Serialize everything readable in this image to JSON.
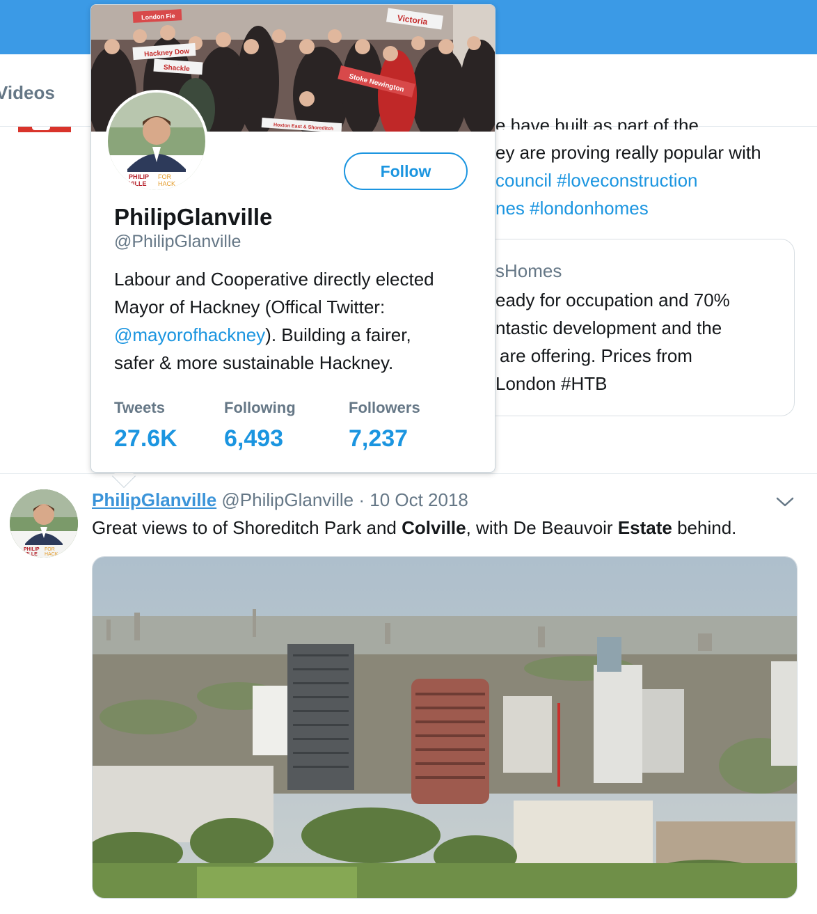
{
  "tabs": {
    "videos": "Videos"
  },
  "background_tweet": {
    "text_lines": [
      "e have built as part of the",
      "ey are proving really popular with",
      "council #loveconstruction",
      "nes #londonhomes"
    ],
    "quote": {
      "source": "sHomes",
      "lines": [
        "eady for occupation and 70%",
        "ntastic development and the",
        "are offering. Prices from",
        "London #HTB"
      ]
    }
  },
  "profile_card": {
    "follow_label": "Follow",
    "name": "PhilipGlanville",
    "handle": "@PhilipGlanville",
    "bio_lines": [
      "Labour and Cooperative directly elected",
      "Mayor of Hackney (Offical Twitter:",
      "). Building a fairer,",
      "safer & more sustainable Hackney."
    ],
    "bio_mention": "@mayorofhackney",
    "avatar_badge": {
      "line1": "PHILIP",
      "line1b": "FOR",
      "line2": "VILLE",
      "line2b": "HACK"
    },
    "banner_signs": [
      "Victoria",
      "Hackney Dow",
      "Shackle",
      "Stoke Newington",
      "London Fie",
      "Hoxton East & Shoreditch"
    ],
    "stats": [
      {
        "label": "Tweets",
        "value": "27.6K"
      },
      {
        "label": "Following",
        "value": "6,493"
      },
      {
        "label": "Followers",
        "value": "7,237"
      }
    ]
  },
  "tweet": {
    "name": "PhilipGlanville",
    "handle": "@PhilipGlanville",
    "separator": "·",
    "date": "10 Oct 2018",
    "text_parts": [
      "Great views to of Shoreditch Park and ",
      "Colville",
      ", with De Beauvoir ",
      "Estate",
      " behind."
    ],
    "avatar_badge": {
      "line1": "PHILIP",
      "line1b": "FOR",
      "line2": "VILLE",
      "line2b": "HACK"
    }
  },
  "colors": {
    "topbar": "#3b9ae6",
    "link": "#1b95e0",
    "muted": "#657786",
    "party_red": "#d9342b"
  },
  "icons": {
    "tweet_menu": "chevron-down-icon"
  }
}
